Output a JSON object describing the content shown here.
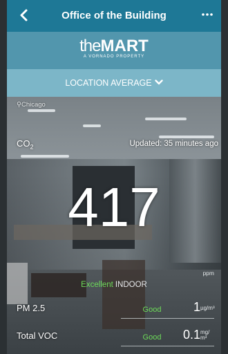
{
  "header": {
    "title": "Office of the Building",
    "back_icon": "chevron-left-icon",
    "more_icon": "more-horizontal-icon"
  },
  "brand": {
    "name_light": "the",
    "name_bold": "MART",
    "subtitle": "A VORNADO PROPERTY"
  },
  "location": {
    "label": "LOCATION AVERAGE",
    "chevron_icon": "chevron-down-icon"
  },
  "overlay": {
    "city": "Chicago",
    "metric": "CO",
    "metric_sub": "2",
    "updated": "Updated: 35 minutes ago",
    "value": "417",
    "unit": "ppm",
    "quality": "Excellent",
    "context": "INDOOR"
  },
  "rows": [
    {
      "label": "PM 2.5",
      "status": "Good",
      "value": "1",
      "unit_top": "µg/m³",
      "unit_bottom": ""
    },
    {
      "label": "Total VOC",
      "status": "Good",
      "value": "0.1",
      "unit_top": "mg/",
      "unit_bottom": "m³"
    }
  ],
  "colors": {
    "topbar": "#1e7896",
    "brandbar": "#5296ad",
    "locbar": "#7cb6c8",
    "good": "#6ddc59"
  }
}
